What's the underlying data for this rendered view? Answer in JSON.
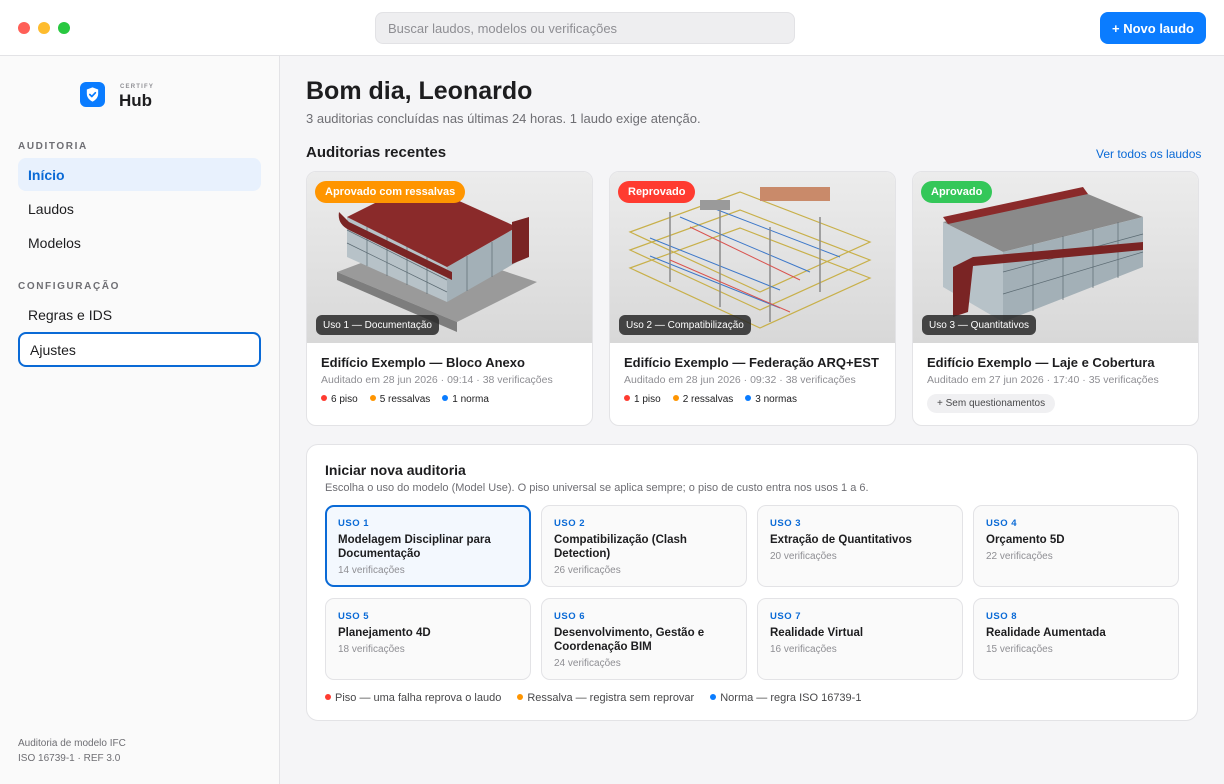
{
  "search": {
    "placeholder": "Buscar laudos, modelos ou verificações"
  },
  "toolbar": {
    "new_label": "+ Novo laudo"
  },
  "brand": {
    "small": "CERTIFY",
    "big": "Hub"
  },
  "sidebar": {
    "sections": [
      {
        "title": "AUDITORIA",
        "items": [
          {
            "label": "Início",
            "active": true
          },
          {
            "label": "Laudos"
          },
          {
            "label": "Modelos"
          }
        ]
      },
      {
        "title": "CONFIGURAÇÃO",
        "items": [
          {
            "label": "Regras e IDS"
          },
          {
            "label": "Ajustes",
            "focused": true
          }
        ]
      }
    ],
    "footer": {
      "line1": "Auditoria de modelo IFC",
      "line2": "ISO 16739-1 · REF 3.0"
    }
  },
  "main": {
    "greeting": "Bom dia, Leonardo",
    "subtitle": "3 auditorias concluídas nas últimas 24 horas. 1 laudo exige atenção.",
    "recent_title": "Auditorias recentes",
    "see_all": "Ver todos os laudos",
    "cards": [
      {
        "status": "Aprovado com ressalvas",
        "status_color": "#ff9500",
        "uso": "Uso 1 — Documentação",
        "title": "Edifício Exemplo — Bloco Anexo",
        "meta": "Auditado em 28 jun 2026 · 09:14 · 38 verificações",
        "stats": [
          "6 piso",
          "5 ressalvas",
          "1 norma"
        ]
      },
      {
        "status": "Reprovado",
        "status_color": "#ff3b30",
        "uso": "Uso 2 — Compatibilização",
        "title": "Edifício Exemplo — Federação ARQ+EST",
        "meta": "Auditado em 28 jun 2026 · 09:32 · 38 verificações",
        "stats": [
          "1 piso",
          "2 ressalvas",
          "3 normas"
        ]
      },
      {
        "status": "Aprovado",
        "status_color": "#34c759",
        "uso": "Uso 3 — Quantitativos",
        "title": "Edifício Exemplo — Laje e Cobertura",
        "meta": "Auditado em 27 jun 2026 · 17:40 · 35 verificações",
        "chip": "+ Sem questionamentos"
      }
    ],
    "new_audit": {
      "title": "Iniciar nova auditoria",
      "subtitle": "Escolha o uso do modelo (Model Use). O piso universal se aplica sempre; o piso de custo entra nos usos 1 a 6.",
      "uses": [
        {
          "code": "USO 1",
          "name": "Modelagem Disciplinar para Documentação",
          "count": "14 verificações",
          "selected": true
        },
        {
          "code": "USO 2",
          "name": "Compatibilização (Clash Detection)",
          "count": "26 verificações"
        },
        {
          "code": "USO 3",
          "name": "Extração de Quantitativos",
          "count": "20 verificações"
        },
        {
          "code": "USO 4",
          "name": "Orçamento 5D",
          "count": "22 verificações"
        },
        {
          "code": "USO 5",
          "name": "Planejamento 4D",
          "count": "18 verificações"
        },
        {
          "code": "USO 6",
          "name": "Desenvolvimento, Gestão e Coordenação BIM",
          "count": "24 verificações"
        },
        {
          "code": "USO 7",
          "name": "Realidade Virtual",
          "count": "16 verificações"
        },
        {
          "code": "USO 8",
          "name": "Realidade Aumentada",
          "count": "15 verificações"
        }
      ],
      "legend": [
        {
          "label": "Piso — uma falha reprova o laudo",
          "color": "#ff3b30"
        },
        {
          "label": "Ressalva — registra sem reprovar",
          "color": "#ff9500"
        },
        {
          "label": "Norma — regra ISO 16739-1",
          "color": "#0a7cff"
        }
      ]
    }
  },
  "colors": {
    "accent": "#0a7cff",
    "piso": "#ff3b30",
    "ressalva": "#ff9500",
    "norma": "#0a7cff"
  },
  "icons": {
    "logo": "shield-check-icon"
  }
}
